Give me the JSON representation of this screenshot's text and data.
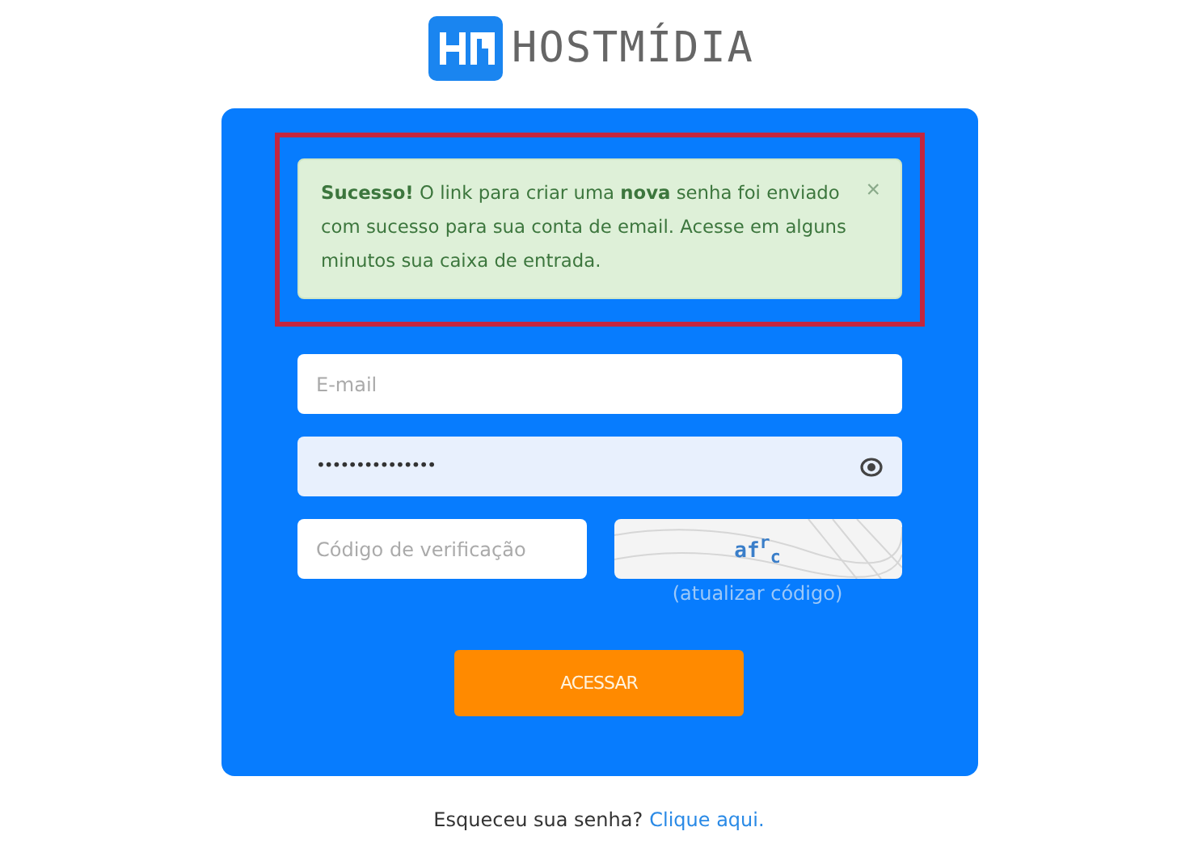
{
  "logo": {
    "text": "HOSTMÍDIA"
  },
  "alert": {
    "highlighted": true,
    "message": "**Sucesso!** O link para criar uma **nova** senha foi enviado com sucesso para sua conta de email. Acesse em alguns minutos sua caixa de entrada.",
    "close": "×"
  },
  "email": {
    "placeholder": "E-mail"
  },
  "password": {
    "value": "•••••••••••••••"
  },
  "code": {
    "placeholder": "Código de verificação"
  },
  "captcha": {
    "text": "af$^{r}$$_{c}$",
    "refresh": "(atualizar código)"
  },
  "submit": "ACESSAR",
  "footer": {
    "text": "Esqueceu sua senha?",
    "link": "Clique aqui."
  }
}
